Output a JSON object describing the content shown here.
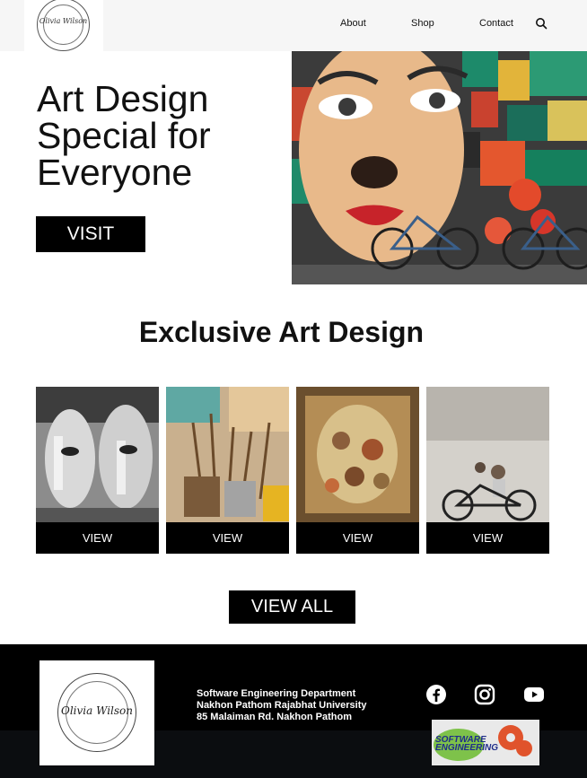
{
  "brand": {
    "logo_alt": "Olivia Wilson - Photography - Art & Design"
  },
  "nav": {
    "items": [
      {
        "label": "About"
      },
      {
        "label": "Shop"
      },
      {
        "label": "Contact"
      }
    ],
    "search_icon": "search-icon"
  },
  "hero": {
    "title_line1": "Art Design",
    "title_line2": "Special for",
    "title_line3": "Everyone",
    "visit_label": "VISIT"
  },
  "section": {
    "title": "Exclusive Art Design",
    "cards": [
      {
        "label": "VIEW"
      },
      {
        "label": "VIEW"
      },
      {
        "label": "VIEW"
      },
      {
        "label": "VIEW"
      }
    ],
    "view_all_label": "VIEW ALL"
  },
  "footer": {
    "address_line1": "Software Engineering Department",
    "address_line2": "Nakhon Pathom Rajabhat University",
    "address_line3": "85 Malaiman Rd. Nakhon Pathom",
    "social": [
      "facebook-icon",
      "instagram-icon",
      "youtube-icon"
    ],
    "se_logo_text": "SOFTWARE ENGINEERING"
  },
  "colors": {
    "accent": "#000000",
    "nav_bg": "#f6f6f6",
    "footer_bg": "#000000"
  }
}
